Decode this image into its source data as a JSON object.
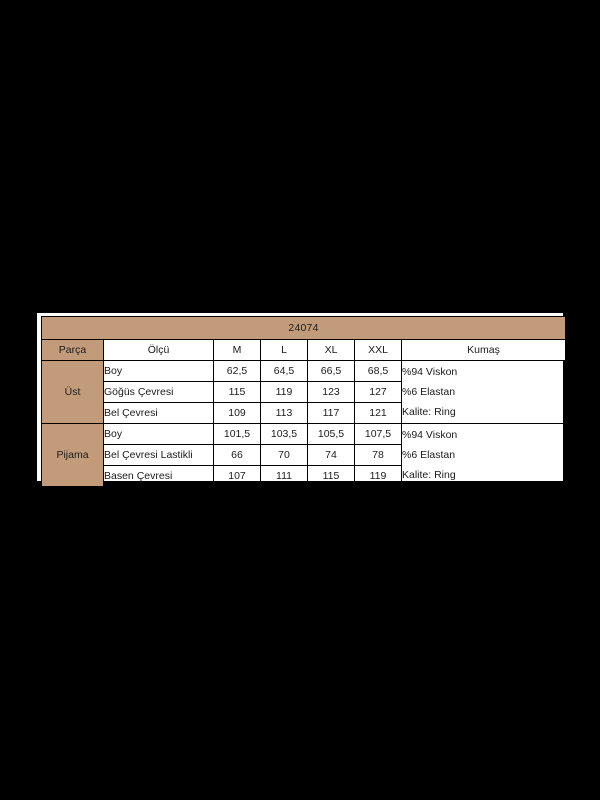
{
  "table": {
    "title": "24074",
    "columns": {
      "group": "Parça",
      "measure": "Ölçü",
      "sizes": [
        "M",
        "L",
        "XL",
        "XXL"
      ],
      "fabric": "Kumaş"
    },
    "groups": [
      {
        "name": "Üst",
        "rows": [
          {
            "measure": "Boy",
            "values": [
              "62,5",
              "64,5",
              "66,5",
              "68,5"
            ]
          },
          {
            "measure": "Göğüs Çevresi",
            "values": [
              "115",
              "119",
              "123",
              "127"
            ]
          },
          {
            "measure": "Bel Çevresi",
            "values": [
              "109",
              "113",
              "117",
              "121"
            ]
          }
        ],
        "fabric_lines": [
          "%94 Viskon",
          "%6 Elastan",
          "Kalite: Ring"
        ]
      },
      {
        "name": "Pijama",
        "rows": [
          {
            "measure": "Boy",
            "values": [
              "101,5",
              "103,5",
              "105,5",
              "107,5"
            ]
          },
          {
            "measure": "Bel Çevresi Lastikli",
            "values": [
              "66",
              "70",
              "74",
              "78"
            ]
          },
          {
            "measure": "Basen Çevresi",
            "values": [
              "107",
              "111",
              "115",
              "119"
            ]
          }
        ],
        "fabric_lines": [
          "%94 Viskon",
          "%6 Elastan",
          "Kalite: Ring"
        ]
      }
    ],
    "colors": {
      "accent": "#c29c7a",
      "background": "#000000",
      "surface": "#ffffff",
      "border": "#000000",
      "text": "#1b1b1b"
    }
  }
}
